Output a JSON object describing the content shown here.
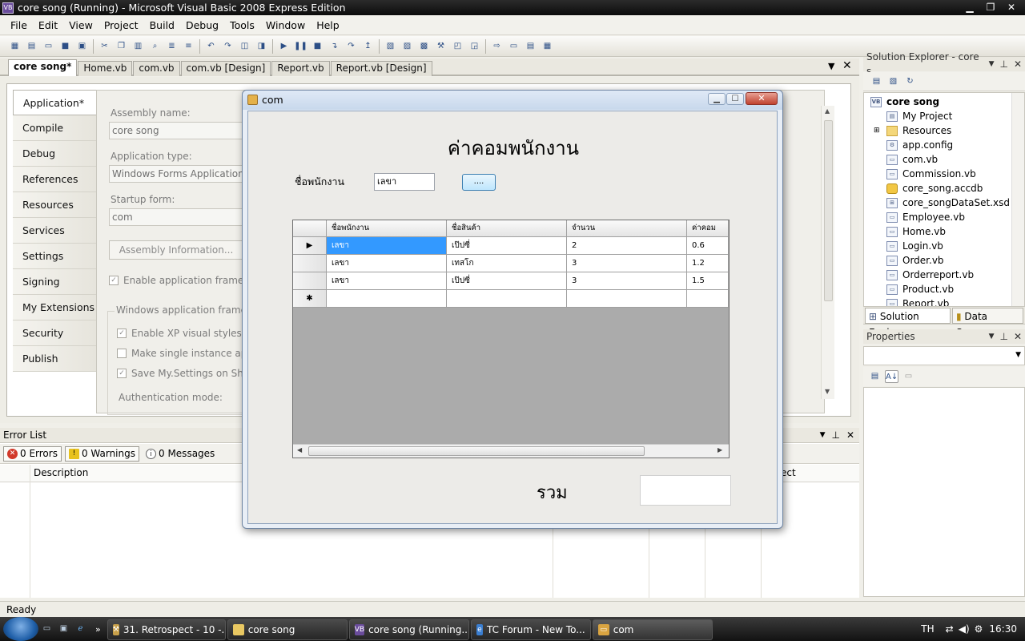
{
  "window": {
    "title": "core song (Running) - Microsoft Visual Basic 2008 Express Edition"
  },
  "menu": [
    "File",
    "Edit",
    "View",
    "Project",
    "Build",
    "Debug",
    "Tools",
    "Window",
    "Help"
  ],
  "doc_tabs": [
    "core song*",
    "Home.vb",
    "com.vb",
    "com.vb [Design]",
    "Report.vb",
    "Report.vb [Design]"
  ],
  "designer": {
    "side_tabs": [
      "Application*",
      "Compile",
      "Debug",
      "References",
      "Resources",
      "Services",
      "Settings",
      "Signing",
      "My Extensions",
      "Security",
      "Publish"
    ],
    "assembly_name_label": "Assembly name:",
    "assembly_name": "core song",
    "app_type_label": "Application type:",
    "app_type": "Windows Forms Application",
    "startup_form_label": "Startup form:",
    "startup_form": "com",
    "assembly_info_button": "Assembly Information...",
    "enable_framework": "Enable application framewo",
    "group_label": "Windows application framewo",
    "enable_xp": "Enable XP visual styles",
    "single_instance": "Make single instance appl",
    "save_settings": "Save My.Settings on Shutd",
    "auth_mode": "Authentication mode:"
  },
  "error_list": {
    "title": "Error List",
    "errors": "0 Errors",
    "warnings": "0 Warnings",
    "messages": "0 Messages",
    "col_description": "Description",
    "col_project": "ect"
  },
  "solution_explorer": {
    "title": "Solution Explorer - core s...",
    "items": [
      "core song",
      "My Project",
      "Resources",
      "app.config",
      "com.vb",
      "Commission.vb",
      "core_song.accdb",
      "core_songDataSet.xsd",
      "Employee.vb",
      "Home.vb",
      "Login.vb",
      "Order.vb",
      "Orderreport.vb",
      "Product.vb",
      "Report.vb"
    ],
    "tab_solution": "Solution Explo...",
    "tab_datasources": "Data Sources"
  },
  "properties": {
    "title": "Properties"
  },
  "status": "Ready",
  "form": {
    "title": "com",
    "heading": "ค่าคอมพนักงาน",
    "employee_label": "ชื่อพนักงาน",
    "employee_value": "เลขา",
    "browse_button": "....",
    "total_label": "รวม",
    "total_value": ""
  },
  "grid": {
    "columns": [
      "ชื่อพนักงาน",
      "ชื่อสินค้า",
      "จำนวน",
      "ค่าคอม"
    ],
    "rows": [
      [
        "เลขา",
        "เป๊ปซี่",
        "2",
        "0.6"
      ],
      [
        "เลขา",
        "เทสโก",
        "3",
        "1.2"
      ],
      [
        "เลขา",
        "เป๊ปซี่",
        "3",
        "1.5"
      ]
    ]
  },
  "taskbar": {
    "items": [
      "31. Retrospect - 10 -...",
      "core song",
      "core song (Running...",
      "TC Forum - New To...",
      "com"
    ],
    "lang": "TH",
    "clock": "16:30"
  }
}
